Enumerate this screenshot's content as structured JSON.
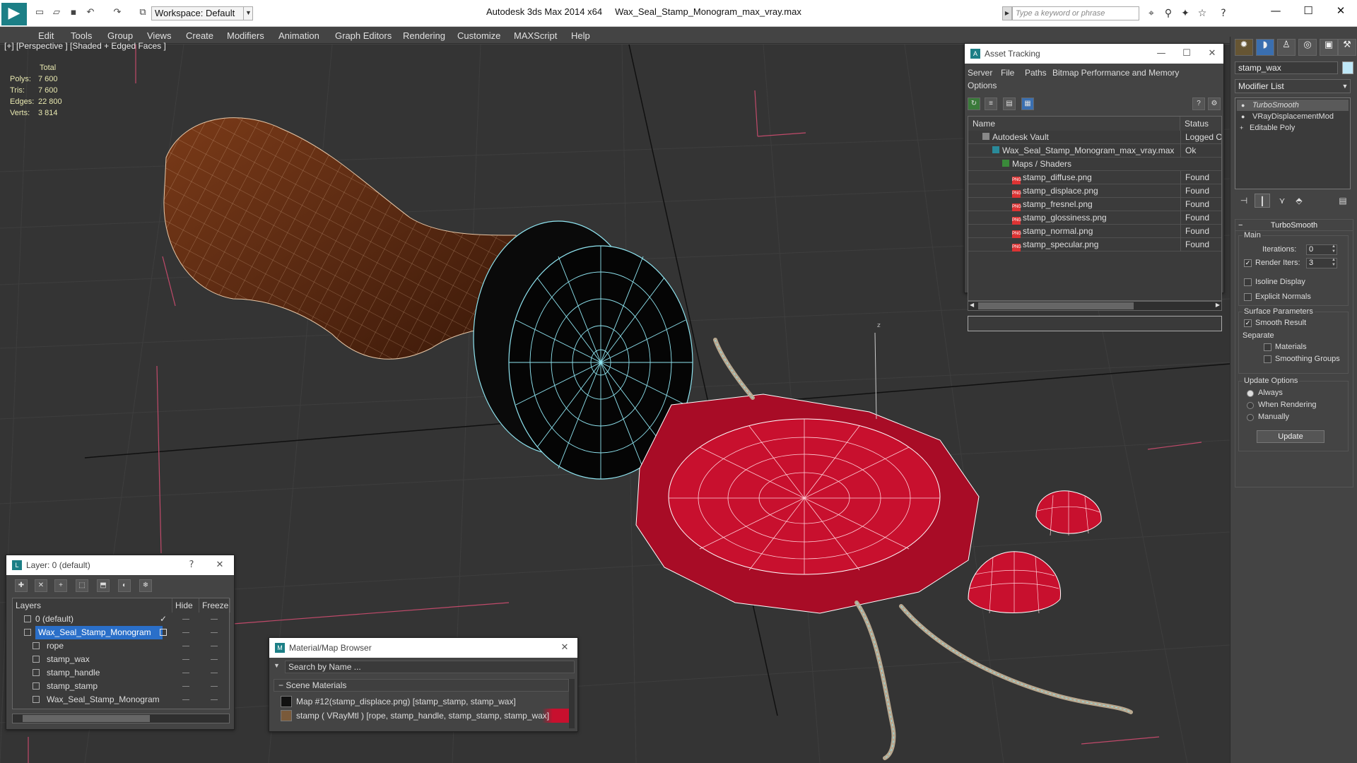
{
  "app": {
    "title": "Autodesk 3ds Max  2014 x64",
    "file": "Wax_Seal_Stamp_Monogram_max_vray.max",
    "workspace": "Workspace: Default",
    "keyword_placeholder": "Type a keyword or phrase"
  },
  "menu": [
    "Edit",
    "Tools",
    "Group",
    "Views",
    "Create",
    "Modifiers",
    "Animation",
    "Graph Editors",
    "Rendering",
    "Customize",
    "MAXScript",
    "Help"
  ],
  "viewport": {
    "label": "[+] [Perspective ] [Shaded + Edged Faces ]",
    "stats": {
      "header": "Total",
      "rows": [
        {
          "k": "Polys:",
          "v": "7 600"
        },
        {
          "k": "Tris:",
          "v": "7 600"
        },
        {
          "k": "Edges:",
          "v": "22 800"
        },
        {
          "k": "Verts:",
          "v": "3 814"
        }
      ]
    },
    "gizmo_label": "z"
  },
  "asset_tracking": {
    "title": "Asset Tracking",
    "menu": [
      "Server",
      "File",
      "Paths",
      "Bitmap Performance and Memory",
      "Options"
    ],
    "columns": [
      "Name",
      "Status"
    ],
    "rows": [
      {
        "name": "Autodesk Vault",
        "status": "Logged O",
        "indent": 0,
        "icon": "vault"
      },
      {
        "name": "Wax_Seal_Stamp_Monogram_max_vray.max",
        "status": "Ok",
        "indent": 1,
        "icon": "max"
      },
      {
        "name": "Maps / Shaders",
        "status": "",
        "indent": 2,
        "icon": "maps"
      },
      {
        "name": "stamp_diffuse.png",
        "status": "Found",
        "indent": 3,
        "icon": "png"
      },
      {
        "name": "stamp_displace.png",
        "status": "Found",
        "indent": 3,
        "icon": "png"
      },
      {
        "name": "stamp_fresnel.png",
        "status": "Found",
        "indent": 3,
        "icon": "png"
      },
      {
        "name": "stamp_glossiness.png",
        "status": "Found",
        "indent": 3,
        "icon": "png"
      },
      {
        "name": "stamp_normal.png",
        "status": "Found",
        "indent": 3,
        "icon": "png"
      },
      {
        "name": "stamp_specular.png",
        "status": "Found",
        "indent": 3,
        "icon": "png"
      }
    ]
  },
  "layers": {
    "title": "Layer: 0 (default)",
    "columns": [
      "Layers",
      "Hide",
      "Freeze"
    ],
    "rows": [
      {
        "name": "0 (default)",
        "level": 0,
        "selected": false,
        "active": true
      },
      {
        "name": "Wax_Seal_Stamp_Monogram",
        "level": 0,
        "selected": true,
        "active": false
      },
      {
        "name": "rope",
        "level": 1,
        "selected": false,
        "active": false
      },
      {
        "name": "stamp_wax",
        "level": 1,
        "selected": false,
        "active": false
      },
      {
        "name": "stamp_handle",
        "level": 1,
        "selected": false,
        "active": false
      },
      {
        "name": "stamp_stamp",
        "level": 1,
        "selected": false,
        "active": false
      },
      {
        "name": "Wax_Seal_Stamp_Monogram",
        "level": 1,
        "selected": false,
        "active": false
      }
    ]
  },
  "material_browser": {
    "title": "Material/Map Browser",
    "search_placeholder": "Search by Name ...",
    "section": "Scene Materials",
    "rows": [
      {
        "label": "Map #12(stamp_displace.png) [stamp_stamp, stamp_wax]",
        "swatch": "#111111"
      },
      {
        "label": "stamp  ( VRayMtl ) [rope, stamp_handle, stamp_stamp, stamp_wax]",
        "swatch": "#7a5a3a"
      }
    ]
  },
  "command_panel": {
    "object_name": "stamp_wax",
    "modifier_list": "Modifier List",
    "stack": [
      "TurboSmooth",
      "VRayDisplacementMod",
      "Editable Poly"
    ],
    "turbosmooth": {
      "title": "TurboSmooth",
      "main": "Main",
      "iterations_label": "Iterations:",
      "iterations": "0",
      "render_iters_label": "Render Iters:",
      "render_iters": "3",
      "render_iters_checked": true,
      "isoline": "Isoline Display",
      "explicit_normals": "Explicit Normals",
      "surface_params": "Surface Parameters",
      "smooth_result": "Smooth Result",
      "smooth_result_checked": true,
      "separate": "Separate",
      "materials": "Materials",
      "smoothing_groups": "Smoothing Groups",
      "update_options": "Update Options",
      "always": "Always",
      "when_rendering": "When Rendering",
      "manually": "Manually",
      "update_button": "Update"
    }
  },
  "colors": {
    "wood": "#5a2a12",
    "wax": "#c8102e",
    "wire": "#8fe4f0",
    "viewport_bg": "#343434",
    "selection": "#2a6fc9"
  }
}
